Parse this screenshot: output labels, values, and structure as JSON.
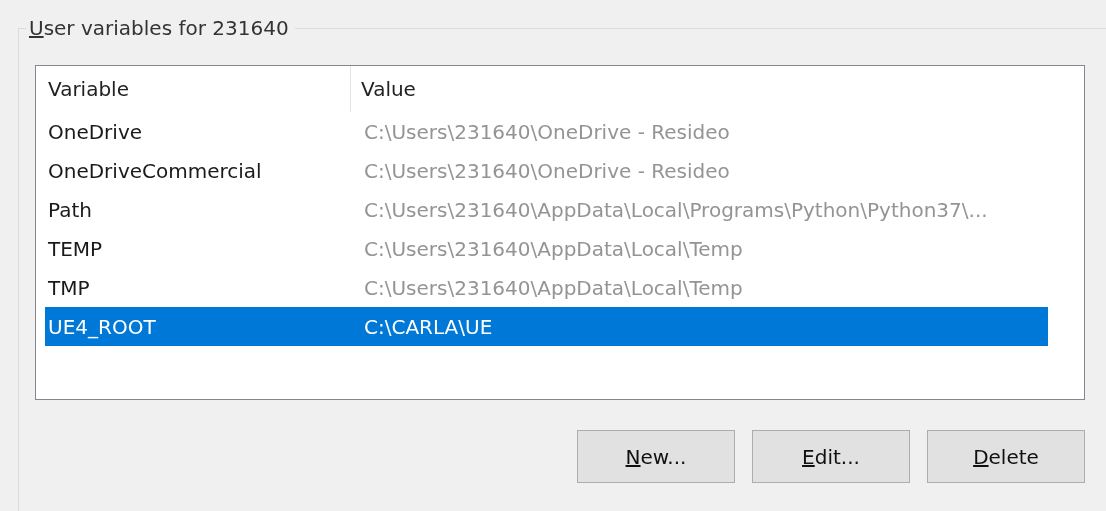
{
  "group": {
    "title": "User variables for 231640",
    "mnemonic": true
  },
  "table": {
    "columns": [
      "Variable",
      "Value"
    ],
    "rows": [
      {
        "variable": "OneDrive",
        "value": "C:\\Users\\231640\\OneDrive - Resideo",
        "selected": false
      },
      {
        "variable": "OneDriveCommercial",
        "value": "C:\\Users\\231640\\OneDrive - Resideo",
        "selected": false
      },
      {
        "variable": "Path",
        "value": "C:\\Users\\231640\\AppData\\Local\\Programs\\Python\\Python37\\...",
        "selected": false
      },
      {
        "variable": "TEMP",
        "value": "C:\\Users\\231640\\AppData\\Local\\Temp",
        "selected": false
      },
      {
        "variable": "TMP",
        "value": "C:\\Users\\231640\\AppData\\Local\\Temp",
        "selected": false
      },
      {
        "variable": "UE4_ROOT",
        "value": "C:\\CARLA\\UE",
        "selected": true
      }
    ]
  },
  "buttons": [
    {
      "label": "New...",
      "mnemonic": true
    },
    {
      "label": "Edit...",
      "mnemonic": true
    },
    {
      "label": "Delete",
      "mnemonic": true
    }
  ]
}
